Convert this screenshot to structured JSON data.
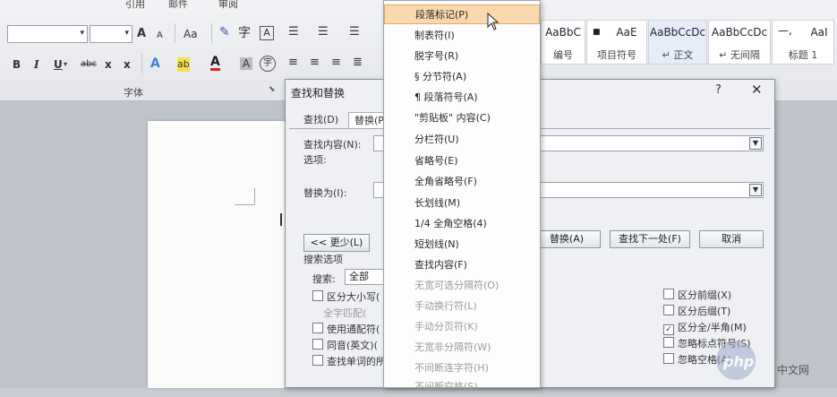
{
  "ribbon": {
    "tabs": [
      "引用",
      "邮件",
      "审阅"
    ],
    "font_group_label": "字体",
    "grow_font": "A",
    "shrink_font": "A",
    "change_case": "Aa",
    "phonetic": "字",
    "char_border": "A",
    "bold": "B",
    "italic": "I",
    "underline": "U",
    "strike": "abc",
    "subscript": "x",
    "superscript": "x",
    "text_effect": "A",
    "highlight": "ab",
    "font_color": "A",
    "char_shade": "A",
    "enclose_char": "字",
    "styles": [
      {
        "sample": "AaBbC",
        "name": "编号"
      },
      {
        "sample": "AaE",
        "name": "项目符号"
      },
      {
        "sample": "AaBbCcDc",
        "name": "↵ 正文"
      },
      {
        "sample": "AaBbCcDc",
        "name": "↵ 无间隔"
      },
      {
        "sample": "AaI",
        "name": "标题 1"
      }
    ]
  },
  "dialog": {
    "title": "查找和替换",
    "help": "?",
    "close": "✕",
    "tabs": [
      "查找(D)",
      "替换(P)"
    ],
    "find_label": "查找内容(N):",
    "options_label": "选项:",
    "replace_label": "替换为(I):",
    "less_button": "<< 更少(L)",
    "replace_button": "替换(A)",
    "find_next_button": "查找下一处(F)",
    "cancel_button": "取消",
    "search_options_label": "搜索选项",
    "search_label": "搜索:",
    "search_value": "全部",
    "left_options": [
      {
        "label": "区分大小写(",
        "checked": false,
        "dim": false
      },
      {
        "label": "全字匹配(",
        "checked": false,
        "dim": true
      },
      {
        "label": "使用通配符(",
        "checked": false,
        "dim": false
      },
      {
        "label": "同音(英文)(",
        "checked": false,
        "dim": false
      },
      {
        "label": "查找单词的所",
        "checked": false,
        "dim": false
      }
    ],
    "right_options": [
      {
        "label": "区分前缀(X)",
        "checked": false
      },
      {
        "label": "区分后缀(T)",
        "checked": false
      },
      {
        "label": "区分全/半角(M)",
        "checked": true
      },
      {
        "label": "忽略标点符号(S)",
        "checked": false
      },
      {
        "label": "忽略空格(A)",
        "checked": false
      }
    ]
  },
  "special_menu": {
    "items": [
      {
        "label": "段落标记(P)",
        "highlighted": true,
        "dim": false
      },
      {
        "label": "制表符(I)",
        "highlighted": false,
        "dim": false
      },
      {
        "label": "脱字号(R)",
        "highlighted": false,
        "dim": false
      },
      {
        "label": "§ 分节符(A)",
        "highlighted": false,
        "dim": false
      },
      {
        "label": "¶ 段落符号(A)",
        "highlighted": false,
        "dim": false
      },
      {
        "label": "\"剪贴板\" 内容(C)",
        "highlighted": false,
        "dim": false
      },
      {
        "label": "分栏符(U)",
        "highlighted": false,
        "dim": false
      },
      {
        "label": "省略号(E)",
        "highlighted": false,
        "dim": false
      },
      {
        "label": "全角省略号(F)",
        "highlighted": false,
        "dim": false
      },
      {
        "label": "长划线(M)",
        "highlighted": false,
        "dim": false
      },
      {
        "label": "1/4 全角空格(4)",
        "highlighted": false,
        "dim": false
      },
      {
        "label": "短划线(N)",
        "highlighted": false,
        "dim": false
      },
      {
        "label": "查找内容(F)",
        "highlighted": false,
        "dim": false
      },
      {
        "label": "无宽可选分隔符(O)",
        "highlighted": false,
        "dim": true
      },
      {
        "label": "手动换行符(L)",
        "highlighted": false,
        "dim": true
      },
      {
        "label": "手动分页符(K)",
        "highlighted": false,
        "dim": true
      },
      {
        "label": "无宽非分隔符(W)",
        "highlighted": false,
        "dim": true
      },
      {
        "label": "不间断连字符(H)",
        "highlighted": false,
        "dim": true
      },
      {
        "label": "不间断空格(S)",
        "highlighted": false,
        "dim": true
      }
    ]
  },
  "watermark": {
    "logo": "php",
    "text": "中文网"
  },
  "colors": {
    "menu_highlight": "#fbd9ae",
    "menu_highlight_border": "#e3a763",
    "ribbon_bg": "#eceef1",
    "dialog_bg": "#eef0f3"
  }
}
